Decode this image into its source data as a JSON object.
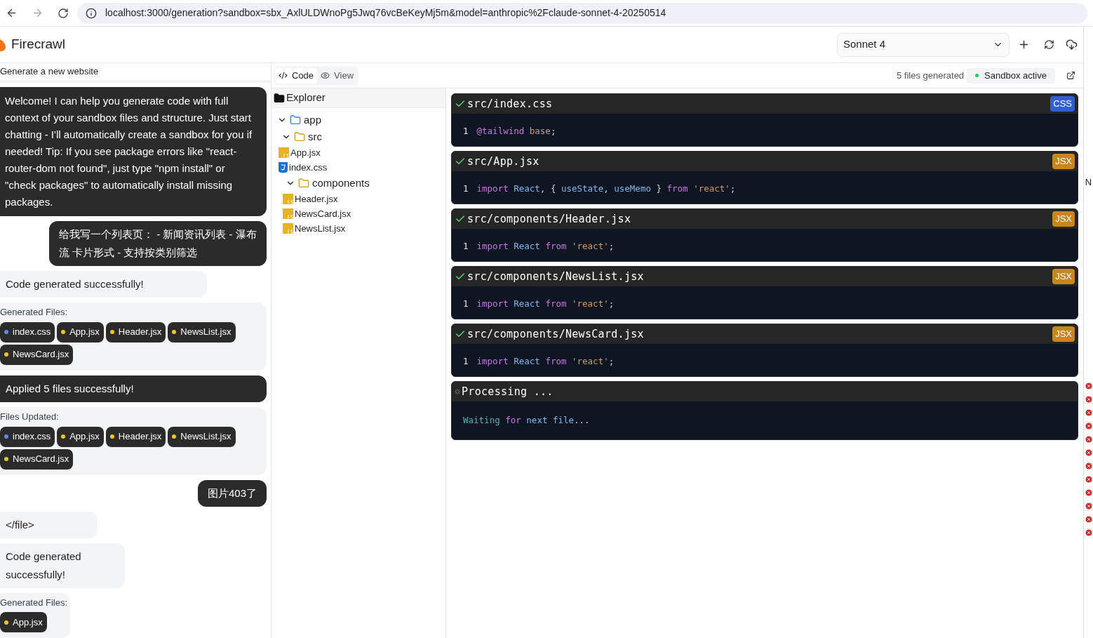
{
  "browser": {
    "url": "localhost:3000/generation?sandbox=sbx_AxlULDWnoPg5Jwq76vcBeKeyMj5m&model=anthropic%2Fclaude-sonnet-4-20250514"
  },
  "header": {
    "brand": "Firecrawl",
    "model": "Sonnet 4"
  },
  "chat": {
    "title": "Generate a new website",
    "messages": [
      {
        "kind": "assistant",
        "text": "Welcome! I can help you generate code with full context of your sandbox files and structure. Just start chatting - I'll automatically create a sandbox for you if needed! Tip: If you see package errors like \"react-router-dom not found\", just type \"npm install\" or \"check packages\" to automatically install missing packages."
      },
      {
        "kind": "user",
        "text": "给我写一个列表页： - 新闻资讯列表 - 瀑布流 卡片形式 - 支持按类别筛选"
      },
      {
        "kind": "status",
        "text": "Code generated successfully!"
      },
      {
        "kind": "files",
        "label": "Generated Files:",
        "files": [
          {
            "name": "index.css",
            "color": "#5b8def"
          },
          {
            "name": "App.jsx",
            "color": "#f5c518"
          },
          {
            "name": "Header.jsx",
            "color": "#f5c518"
          },
          {
            "name": "NewsList.jsx",
            "color": "#f5c518"
          },
          {
            "name": "NewsCard.jsx",
            "color": "#f5c518"
          }
        ]
      },
      {
        "kind": "applied",
        "text": "Applied 5 files successfully!"
      },
      {
        "kind": "files",
        "label": "Files Updated:",
        "files": [
          {
            "name": "index.css",
            "color": "#5b8def"
          },
          {
            "name": "App.jsx",
            "color": "#f5c518"
          },
          {
            "name": "Header.jsx",
            "color": "#f5c518"
          },
          {
            "name": "NewsList.jsx",
            "color": "#f5c518"
          },
          {
            "name": "NewsCard.jsx",
            "color": "#f5c518"
          }
        ]
      },
      {
        "kind": "user",
        "text": "图片403了"
      },
      {
        "kind": "status",
        "text": "</file>"
      },
      {
        "kind": "status",
        "text": "Code generated successfully!",
        "narrow": true
      },
      {
        "kind": "files",
        "label": "Generated Files:",
        "files": [
          {
            "name": "App.jsx",
            "color": "#f5c518"
          }
        ]
      }
    ]
  },
  "tabs": [
    {
      "label": "Code",
      "selected": true
    },
    {
      "label": "View",
      "selected": false
    }
  ],
  "status": {
    "count": "5 files generated",
    "sandbox": "Sandbox active"
  },
  "explorer": {
    "title": "Explorer",
    "tree": [
      {
        "kind": "folder",
        "name": "app",
        "expanded": true,
        "children": [
          {
            "kind": "folder",
            "name": "src",
            "expanded": true,
            "children": [
              {
                "kind": "js",
                "name": "App.jsx"
              },
              {
                "kind": "css",
                "name": "index.css"
              },
              {
                "kind": "folder",
                "name": "components",
                "expanded": true,
                "children": [
                  {
                    "kind": "js",
                    "name": "Header.jsx"
                  },
                  {
                    "kind": "js",
                    "name": "NewsCard.jsx"
                  },
                  {
                    "kind": "js",
                    "name": "NewsList.jsx"
                  }
                ]
              }
            ]
          }
        ]
      }
    ]
  },
  "files": [
    {
      "kind": "done",
      "path": "src/index.css",
      "lang": "CSS",
      "color": "#2f5fd6",
      "line": "1",
      "tokens": [
        {
          "kind": "at",
          "text": "@tailwind"
        },
        {
          "kind": "str",
          "text": " base"
        },
        {
          "kind": "punct",
          "text": ";"
        }
      ]
    },
    {
      "kind": "done",
      "path": "src/App.jsx",
      "lang": "JSX",
      "color": "#c9861d",
      "line": "1",
      "tokens": [
        {
          "kind": "kw",
          "text": "import "
        },
        {
          "kind": "id",
          "text": "React"
        },
        {
          "kind": "punct",
          "text": ", { "
        },
        {
          "kind": "id",
          "text": "useState"
        },
        {
          "kind": "punct",
          "text": ", "
        },
        {
          "kind": "id",
          "text": "useMemo"
        },
        {
          "kind": "punct",
          "text": " } "
        },
        {
          "kind": "kw",
          "text": "from "
        },
        {
          "kind": "str",
          "text": "'react'"
        },
        {
          "kind": "punct",
          "text": ";"
        }
      ]
    },
    {
      "kind": "done",
      "path": "src/components/Header.jsx",
      "lang": "JSX",
      "color": "#c9861d",
      "line": "1",
      "tokens": [
        {
          "kind": "kw",
          "text": "import "
        },
        {
          "kind": "id",
          "text": "React "
        },
        {
          "kind": "kw",
          "text": "from "
        },
        {
          "kind": "str",
          "text": "'react'"
        },
        {
          "kind": "punct",
          "text": ";"
        }
      ]
    },
    {
      "kind": "done",
      "path": "src/components/NewsList.jsx",
      "lang": "JSX",
      "color": "#c9861d",
      "line": "1",
      "tokens": [
        {
          "kind": "kw",
          "text": "import "
        },
        {
          "kind": "id",
          "text": "React "
        },
        {
          "kind": "kw",
          "text": "from "
        },
        {
          "kind": "str",
          "text": "'react'"
        },
        {
          "kind": "punct",
          "text": ";"
        }
      ]
    },
    {
      "kind": "done",
      "path": "src/components/NewsCard.jsx",
      "lang": "JSX",
      "color": "#c9861d",
      "line": "1",
      "tokens": [
        {
          "kind": "kw",
          "text": "import "
        },
        {
          "kind": "id",
          "text": "React "
        },
        {
          "kind": "kw",
          "text": "from "
        },
        {
          "kind": "str",
          "text": "'react'"
        },
        {
          "kind": "punct",
          "text": ";"
        }
      ]
    },
    {
      "kind": "processing",
      "path": "Processing ...",
      "tokens": [
        {
          "kind": "teal",
          "text": "Waiting "
        },
        {
          "kind": "kw",
          "text": "for "
        },
        {
          "kind": "id",
          "text": "next file"
        },
        {
          "kind": "punct",
          "text": "..."
        }
      ]
    }
  ],
  "devtools": {
    "letter": "N"
  }
}
